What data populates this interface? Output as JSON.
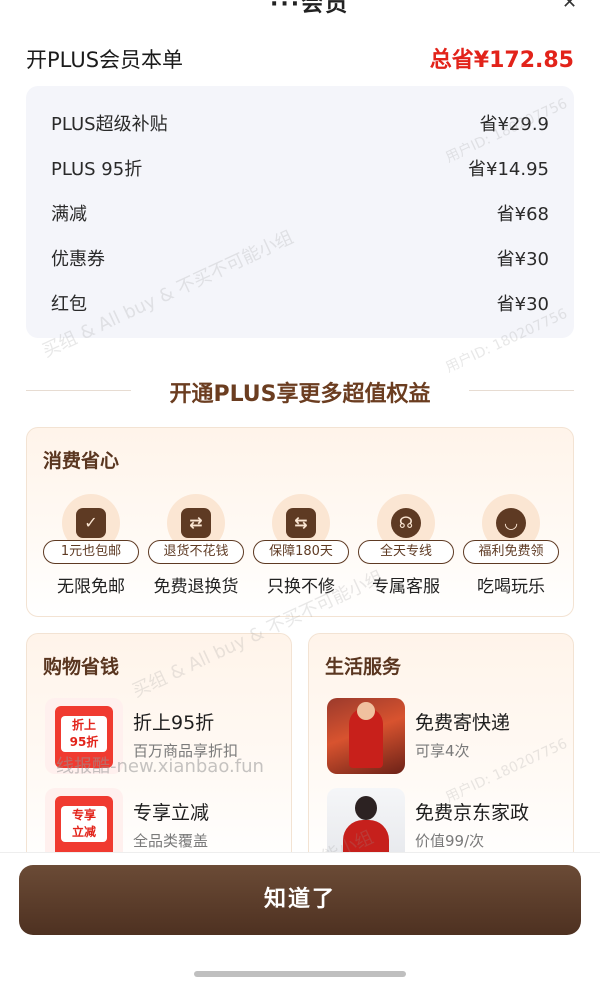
{
  "header": {
    "title": "开PLUS会员本单",
    "total_saving": "总省¥172.85"
  },
  "savings": [
    {
      "label": "PLUS超级补贴",
      "value": "省¥29.9"
    },
    {
      "label": "PLUS 95折",
      "value": "省¥14.95"
    },
    {
      "label": "满减",
      "value": "省¥68"
    },
    {
      "label": "优惠券",
      "value": "省¥30"
    },
    {
      "label": "红包",
      "value": "省¥30"
    }
  ],
  "section_title": "开通PLUS享更多超值权益",
  "consume_card": {
    "title": "消费省心",
    "benefits": [
      {
        "tag": "1元也包邮",
        "name": "无限免邮",
        "icon": "truck-icon"
      },
      {
        "tag": "退货不花钱",
        "name": "免费退换货",
        "icon": "exchange-bag-icon"
      },
      {
        "tag": "保障180天",
        "name": "只换不修",
        "icon": "shield-swap-icon"
      },
      {
        "tag": "全天专线",
        "name": "专属客服",
        "icon": "headset-icon"
      },
      {
        "tag": "福利免费领",
        "name": "吃喝玩乐",
        "icon": "cup-icon"
      }
    ]
  },
  "shopping_card": {
    "title": "购物省钱",
    "items": [
      {
        "name": "折上95折",
        "desc": "百万商品享折扣",
        "thumb_text": "折上\n95折"
      },
      {
        "name": "专享立减",
        "desc": "全品类覆盖",
        "thumb_text": "专享\n立减"
      }
    ]
  },
  "life_card": {
    "title": "生活服务",
    "items": [
      {
        "name": "免费寄快递",
        "desc": "可享4次"
      },
      {
        "name": "免费京东家政",
        "desc": "价值99/次"
      }
    ]
  },
  "confirm_button": "知道了",
  "watermark": {
    "site": "线报酷-new.xianbao.fun",
    "text": "买组 & All buy & 不买不可能小组",
    "user": "用户ID: 180207756"
  }
}
